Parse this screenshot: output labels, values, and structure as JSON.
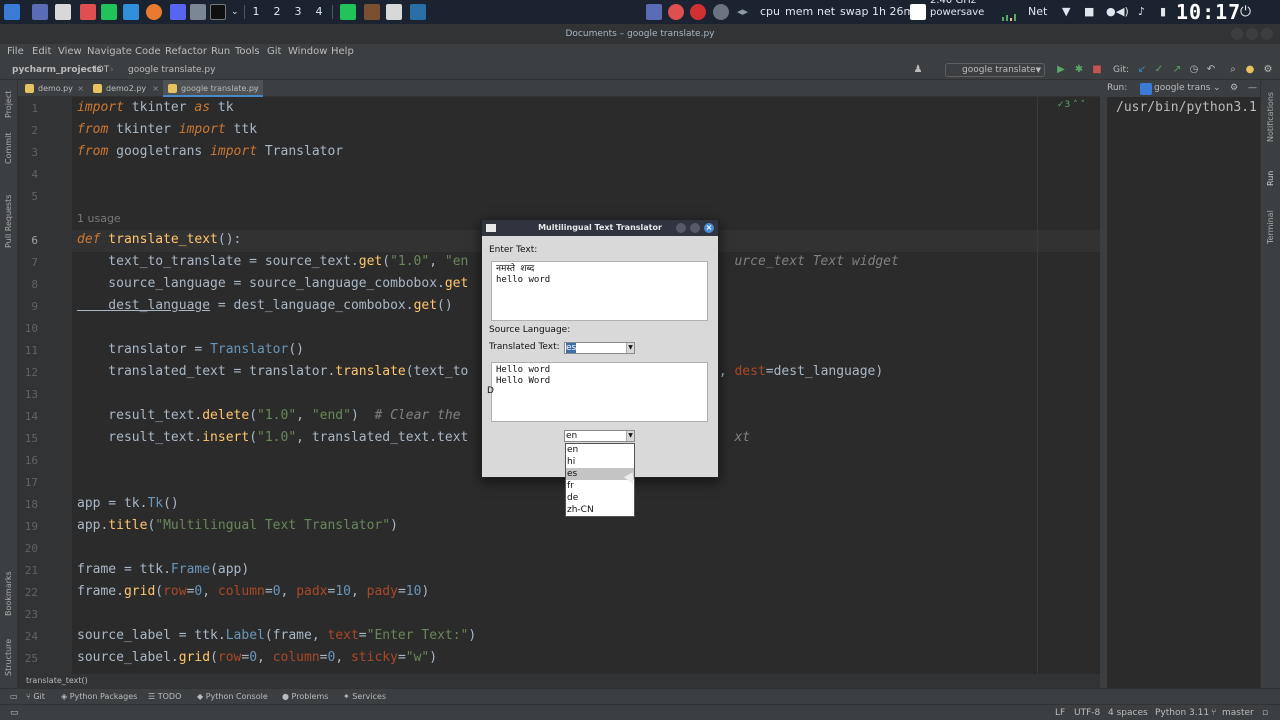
{
  "taskbar": {
    "workspaces": [
      "1",
      "2",
      "3",
      "4"
    ],
    "stats": [
      "cpu",
      "mem",
      "net",
      "swap"
    ],
    "uptime": "1h 26m",
    "cpu_freq": "2.40 GHz",
    "cpu_governor": "powersave",
    "net_label": "Net",
    "clock": "10:17"
  },
  "window": {
    "title": "Documents – google translate.py"
  },
  "menu": [
    "File",
    "Edit",
    "View",
    "Navigate",
    "Code",
    "Refactor",
    "Run",
    "Tools",
    "Git",
    "Window",
    "Help"
  ],
  "breadcrumb": {
    "project": "pycharm_projects",
    "folder": "IOT",
    "file": "google translate.py"
  },
  "run_config": "google translate",
  "git_label": "Git:",
  "tabs": [
    {
      "label": "demo.py",
      "active": false
    },
    {
      "label": "demo2.py",
      "active": false
    },
    {
      "label": "google translate.py",
      "active": true
    }
  ],
  "left_tools": [
    "Project",
    "Commit",
    "Pull Requests",
    "Bookmarks",
    "Structure"
  ],
  "right_tools": [
    "Notifications",
    "Run",
    "Terminal"
  ],
  "editor": {
    "line_numbers": [
      "1",
      "2",
      "3",
      "4",
      "5",
      "6",
      "7",
      "8",
      "9",
      "10",
      "11",
      "12",
      "13",
      "14",
      "15",
      "16",
      "17",
      "18",
      "19",
      "20",
      "21",
      "22",
      "23",
      "24",
      "25"
    ],
    "usage_hint": "1 usage",
    "inspection_count": "3",
    "lines": {
      "l1": {
        "a": "import",
        "b": " tkinter ",
        "c": "as",
        "d": " tk"
      },
      "l2": {
        "a": "from",
        "b": " tkinter ",
        "c": "import",
        "d": " ttk"
      },
      "l3": {
        "a": "from",
        "b": " googletrans ",
        "c": "import",
        "d": " Translator"
      },
      "l6": {
        "a": "def",
        "b": " translate_text",
        "c": "():"
      },
      "l7": {
        "a": "    text_to_translate = source_text.",
        "b": "get",
        "c": "(",
        "d": "\"1.0\"",
        "e": ", ",
        "f": "\"en",
        "g": "                                  urce_text Text widget"
      },
      "l8": {
        "a": "    source_language = source_language_combobox.",
        "b": "get"
      },
      "l9": {
        "a": "    dest_language",
        "b": " = dest_language_combobox.",
        "c": "get",
        "d": "()"
      },
      "l11": {
        "a": "    translator = ",
        "b": "Translator",
        "c": "()"
      },
      "l12": {
        "a": "    translated_text = translator.",
        "b": "translate",
        "c": "(text_to",
        "d": "                               e, ",
        "e": "dest",
        "f": "=dest_language)"
      },
      "l14": {
        "a": "    result_text.",
        "b": "delete",
        "c": "(",
        "d": "\"1.0\"",
        "e": ", ",
        "f": "\"end\"",
        "g": ")  ",
        "h": "# Clear the"
      },
      "l15": {
        "a": "    result_text.",
        "b": "insert",
        "c": "(",
        "d": "\"1.0\"",
        "e": ", translated_text.text",
        "f": "                                  xt"
      },
      "l18": {
        "a": "app = tk.",
        "b": "Tk",
        "c": "()"
      },
      "l19": {
        "a": "app.",
        "b": "title",
        "c": "(",
        "d": "\"Multilingual Text Translator\"",
        "e": ")"
      },
      "l21": {
        "a": "frame = ttk.",
        "b": "Frame",
        "c": "(app)"
      },
      "l22": {
        "a": "frame.",
        "b": "grid",
        "c": "(",
        "d": "row",
        "e": "=",
        "f": "0",
        "g": ", ",
        "h": "column",
        "i": "=",
        "j": "0",
        "k": ", ",
        "l": "padx",
        "m": "=",
        "n": "10",
        "o": ", ",
        "p": "pady",
        "q": "=",
        "r": "10",
        "s": ")"
      },
      "l24": {
        "a": "source_label = ttk.",
        "b": "Label",
        "c": "(frame, ",
        "d": "text",
        "e": "=",
        "f": "\"Enter Text:\"",
        "g": ")"
      },
      "l25": {
        "a": "source_label.",
        "b": "grid",
        "c": "(",
        "d": "row",
        "e": "=",
        "f": "0",
        "g": ", ",
        "h": "column",
        "i": "=",
        "j": "0",
        "k": ", ",
        "l": "sticky",
        "m": "=",
        "n": "\"w\"",
        "o": ")"
      }
    }
  },
  "run_panel": {
    "label": "Run:",
    "config": "google trans",
    "output": "/usr/bin/python3.1"
  },
  "code_breadcrumb": "translate_text()",
  "bottom_tools": [
    "Git",
    "Python Packages",
    "TODO",
    "Python Console",
    "Problems",
    "Services"
  ],
  "status": {
    "line_sep": "LF",
    "encoding": "UTF-8",
    "indent": "4 spaces",
    "interpreter": "Python 3.11",
    "branch": "master"
  },
  "dialog": {
    "title": "Multilingual Text Translator",
    "enter_text_label": "Enter Text:",
    "source_text": "नमस्ते शब्द\nhello word",
    "source_language_label": "Source Language:",
    "translated_text_label": "Translated Text:",
    "dest_combo_value": "es",
    "result_text": "Hello word\nHello Word",
    "result_stray_char": "D",
    "source_combo_value": "en",
    "dropdown_options": [
      "en",
      "hi",
      "es",
      "fr",
      "de",
      "zh-CN"
    ],
    "dropdown_highlighted": "es"
  }
}
